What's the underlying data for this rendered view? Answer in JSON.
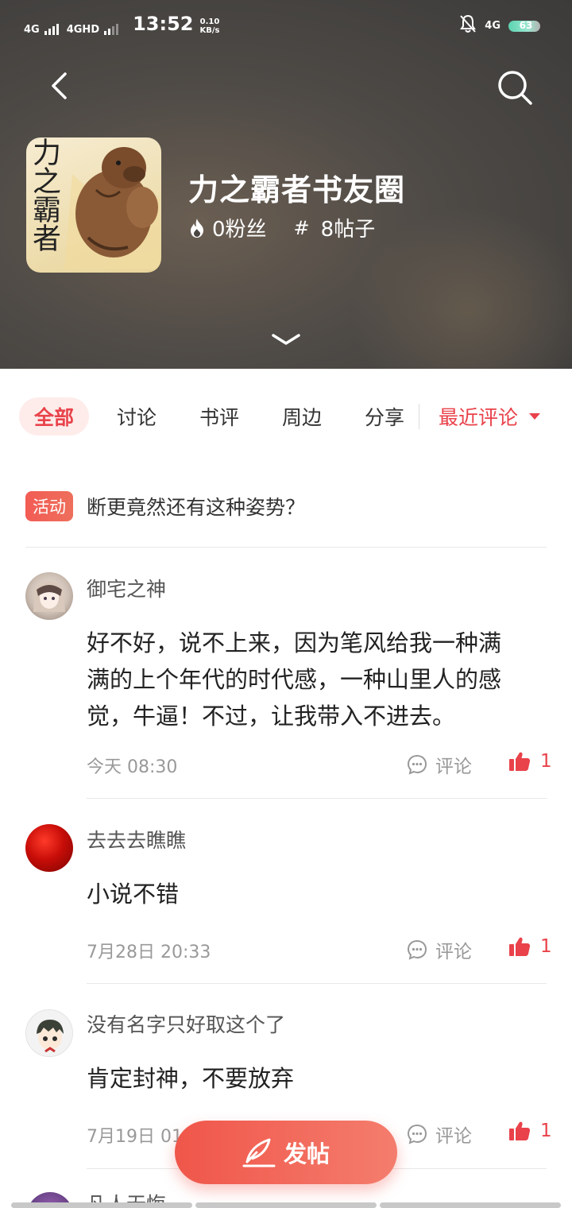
{
  "status_bar": {
    "network_1": "4G",
    "network_2": "4GHD",
    "time": "13:52",
    "speed_value": "0.10",
    "speed_unit": "KB/s",
    "right_network": "4G",
    "battery": "63"
  },
  "header": {
    "cover_text": "力之霸者",
    "title": "力之霸者书友圈",
    "fans": "0粉丝",
    "posts_symbol": "#",
    "posts": "8帖子"
  },
  "tabs": {
    "items": [
      "全部",
      "讨论",
      "书评",
      "周边",
      "分享"
    ],
    "sort": "最近评论"
  },
  "announcement": {
    "badge": "活动",
    "text": "断更竟然还有这种姿势？"
  },
  "posts": [
    {
      "author": "御宅之神",
      "lines": [
        "好不好，说不上来，因为笔风给我一种满",
        "满的上个年代的时代感，一种山里人的感",
        "觉，牛逼！不过，让我带入不进去。"
      ],
      "time": "今天 08:30",
      "comment_label": "评论",
      "likes": "1"
    },
    {
      "author": "去去去瞧瞧",
      "lines": [
        "小说不错"
      ],
      "time": "7月28日 20:33",
      "comment_label": "评论",
      "likes": "1"
    },
    {
      "author": "没有名字只好取这个了",
      "lines": [
        "肯定封神，不要放弃"
      ],
      "time": "7月19日 01",
      "comment_label": "评论",
      "likes": "1"
    }
  ],
  "next_post_author": "凡人无悔",
  "fab": {
    "label": "发帖"
  },
  "colors": {
    "accent": "#e9424a",
    "header_bg": "#4a4744"
  }
}
